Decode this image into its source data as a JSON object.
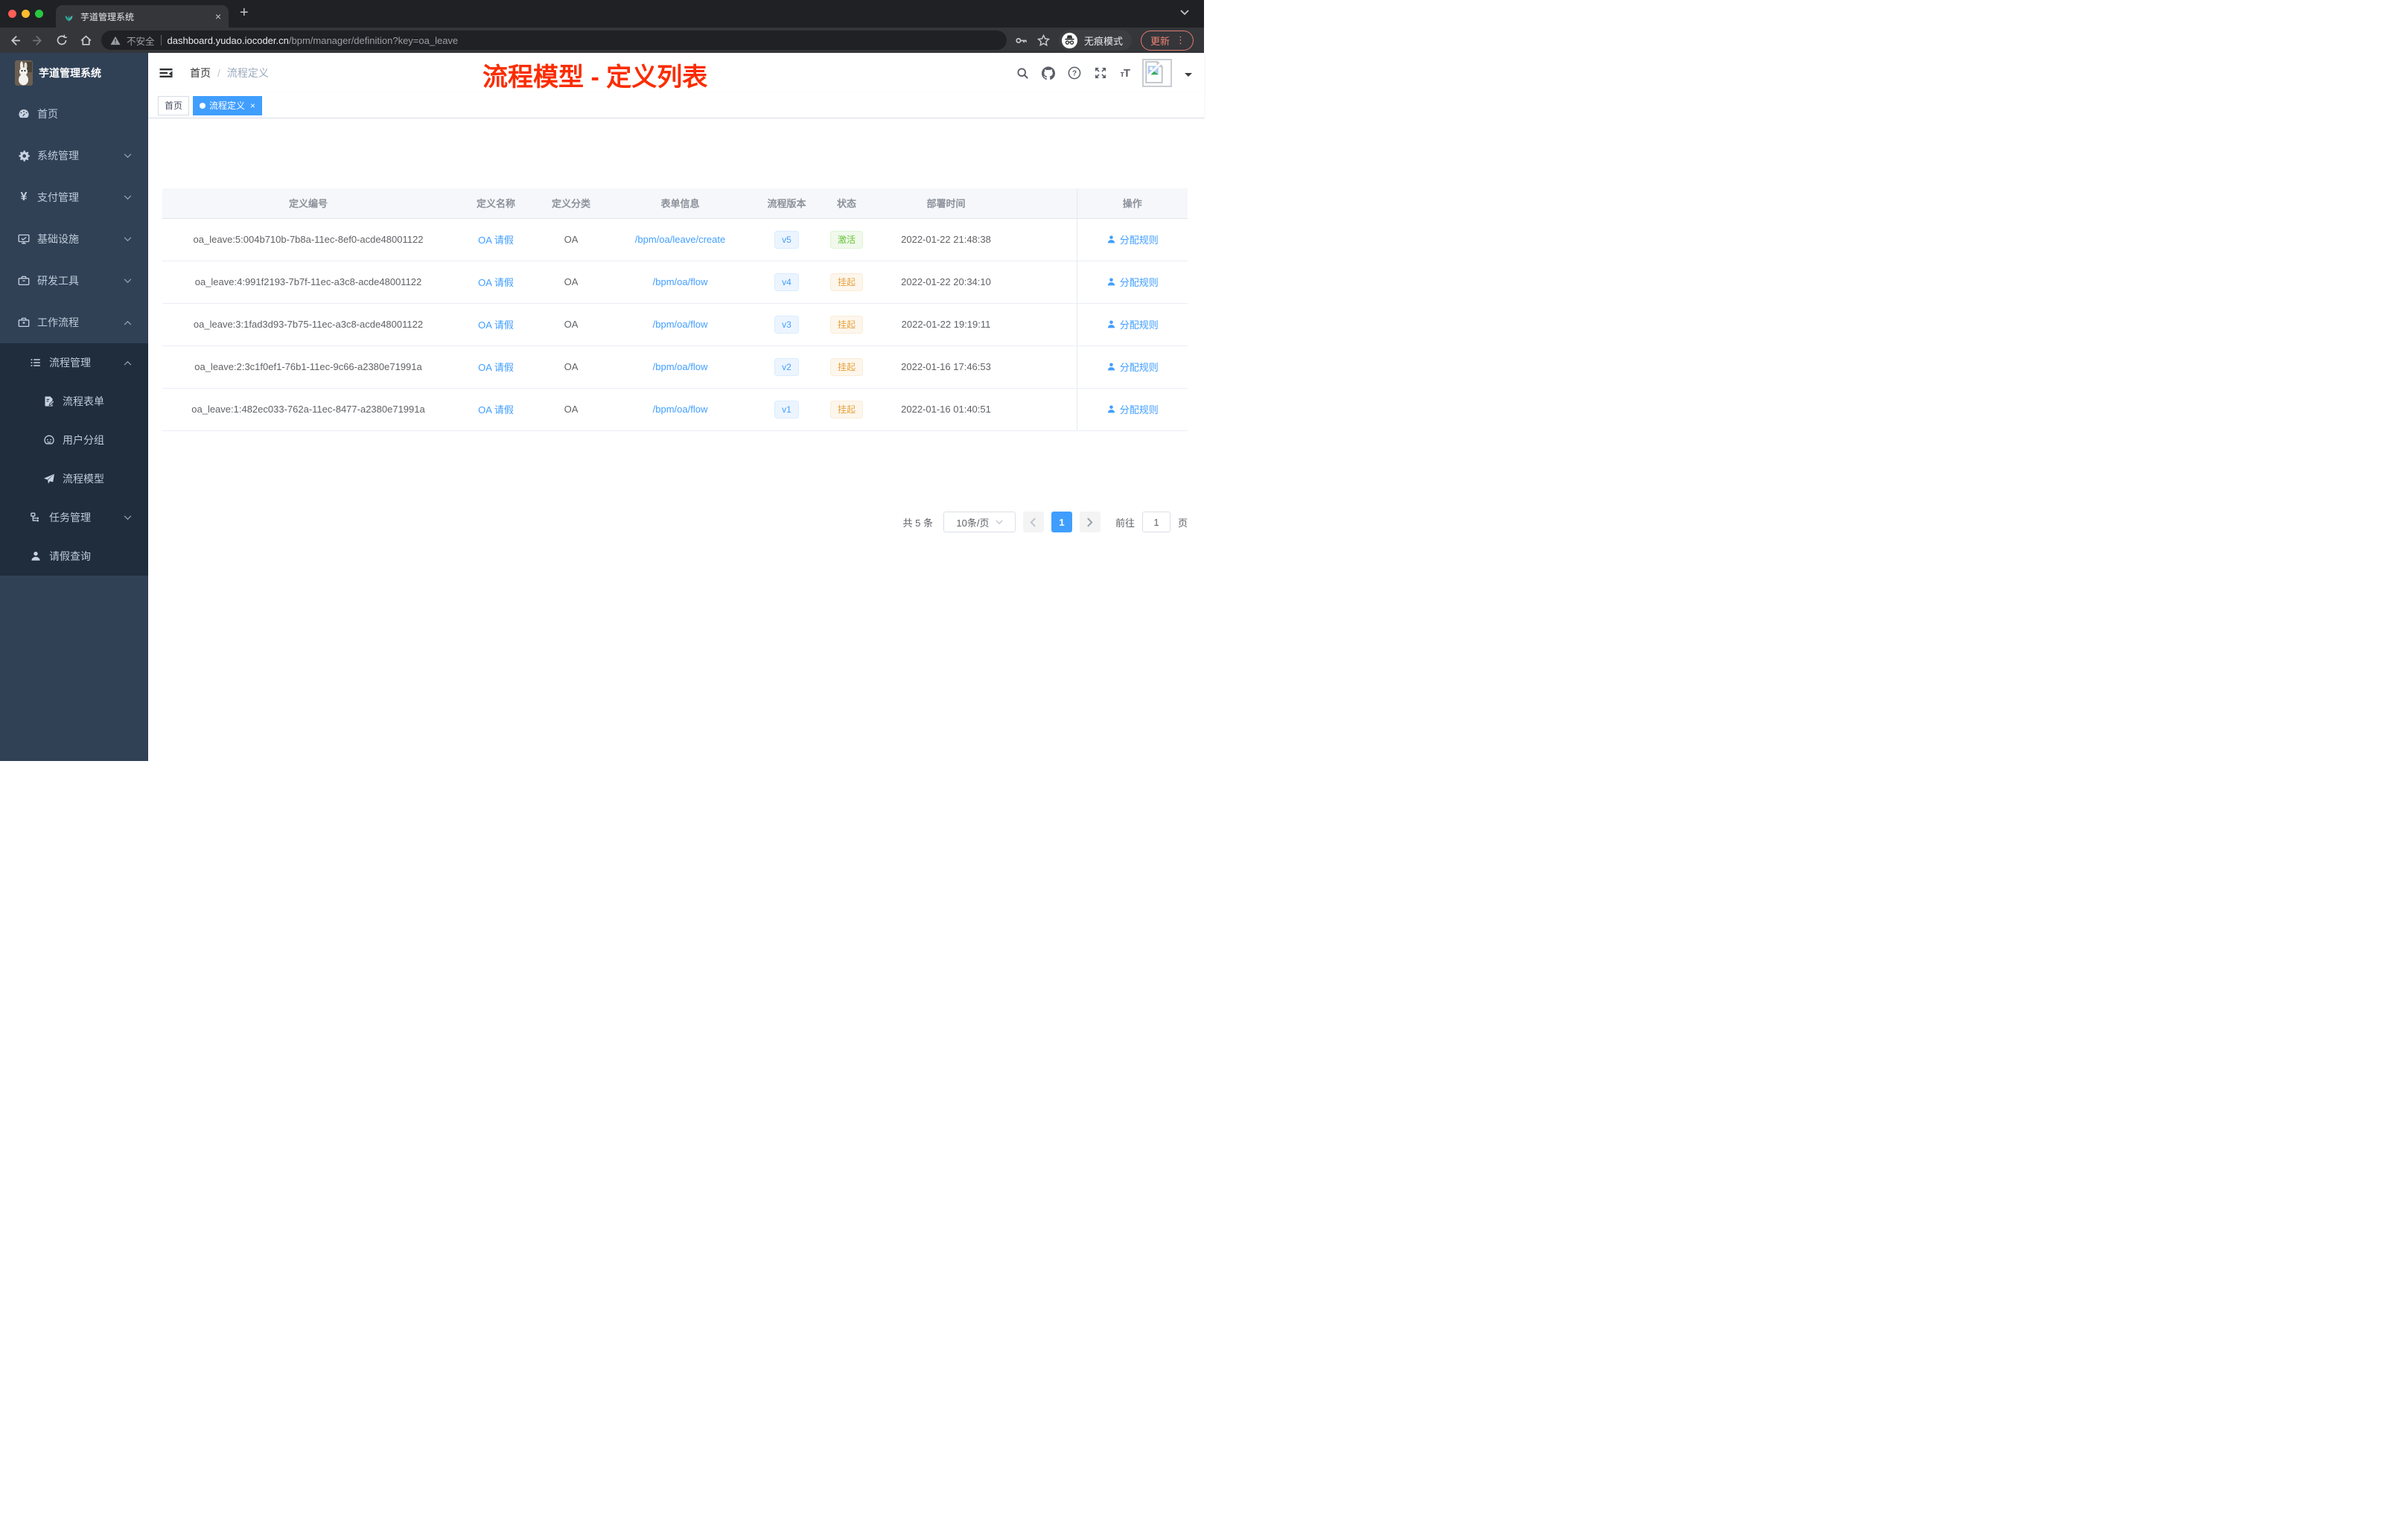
{
  "browser": {
    "tab_title": "芋道管理系统",
    "new_tab": "+",
    "close_tab": "×",
    "security_label": "不安全",
    "url_domain": "dashboard.yudao.iocoder.cn",
    "url_path": "/bpm/manager/definition?key=oa_leave",
    "incognito_label": "无痕模式",
    "update_label": "更新",
    "menu_dots": "⋮"
  },
  "annotation": {
    "text": "流程模型 - 定义列表",
    "color": "#fb2c00"
  },
  "sidebar": {
    "title": "芋道管理系统",
    "items": [
      {
        "label": "首页"
      },
      {
        "label": "系统管理"
      },
      {
        "label": "支付管理"
      },
      {
        "label": "基础设施"
      },
      {
        "label": "研发工具"
      },
      {
        "label": "工作流程"
      },
      {
        "label": "流程管理"
      },
      {
        "label": "流程表单"
      },
      {
        "label": "用户分组"
      },
      {
        "label": "流程模型"
      },
      {
        "label": "任务管理"
      },
      {
        "label": "请假查询"
      }
    ]
  },
  "header": {
    "breadcrumb": [
      "首页",
      "流程定义"
    ],
    "breadcrumb_separator": "/"
  },
  "tags": [
    {
      "label": "首页"
    },
    {
      "label": "流程定义"
    }
  ],
  "table": {
    "columns": [
      "定义编号",
      "定义名称",
      "定义分类",
      "表单信息",
      "流程版本",
      "状态",
      "部署时间",
      "操作"
    ],
    "rows": [
      {
        "id": "oa_leave:5:004b710b-7b8a-11ec-8ef0-acde48001122",
        "name": "OA 请假",
        "category": "OA",
        "form": "/bpm/oa/leave/create",
        "version": "v5",
        "status": "激活",
        "time": "2022-01-22 21:48:38",
        "action": "分配规则"
      },
      {
        "id": "oa_leave:4:991f2193-7b7f-11ec-a3c8-acde48001122",
        "name": "OA 请假",
        "category": "OA",
        "form": "/bpm/oa/flow",
        "version": "v4",
        "status": "挂起",
        "time": "2022-01-22 20:34:10",
        "action": "分配规则"
      },
      {
        "id": "oa_leave:3:1fad3d93-7b75-11ec-a3c8-acde48001122",
        "name": "OA 请假",
        "category": "OA",
        "form": "/bpm/oa/flow",
        "version": "v3",
        "status": "挂起",
        "time": "2022-01-22 19:19:11",
        "action": "分配规则"
      },
      {
        "id": "oa_leave:2:3c1f0ef1-76b1-11ec-9c66-a2380e71991a",
        "name": "OA 请假",
        "category": "OA",
        "form": "/bpm/oa/flow",
        "version": "v2",
        "status": "挂起",
        "time": "2022-01-16 17:46:53",
        "action": "分配规则"
      },
      {
        "id": "oa_leave:1:482ec033-762a-11ec-8477-a2380e71991a",
        "name": "OA 请假",
        "category": "OA",
        "form": "/bpm/oa/flow",
        "version": "v1",
        "status": "挂起",
        "time": "2022-01-16 01:40:51",
        "action": "分配规则"
      }
    ]
  },
  "pagination": {
    "total_label": "共 5 条",
    "page_size": "10条/页",
    "current_page": "1",
    "goto_label": "前往",
    "goto_value": "1",
    "page_label": "页"
  },
  "colors": {
    "accent": "#409eff",
    "success": "#67c23a",
    "warning": "#e6a23c",
    "sidebar_bg": "#304156",
    "submenu_bg": "#1f2d3d",
    "annotation": "#fb2c00"
  }
}
